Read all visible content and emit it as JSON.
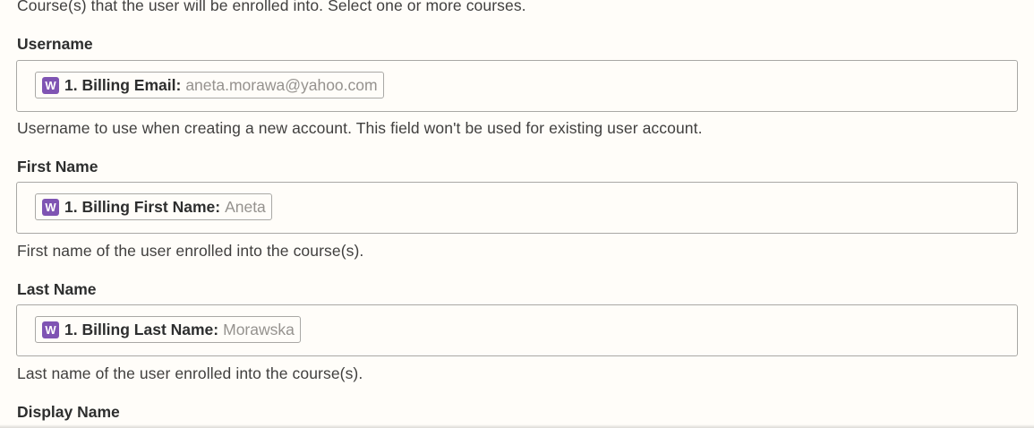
{
  "courses_help": "Course(s) that the user will be enrolled into. Select one or more courses.",
  "username": {
    "label": "Username",
    "pill_app": "W",
    "pill_label": "1. Billing Email:",
    "pill_value": "aneta.morawa@yahoo.com",
    "help": "Username to use when creating a new account. This field won't be used for existing user account."
  },
  "first_name": {
    "label": "First Name",
    "pill_app": "W",
    "pill_label": "1. Billing First Name:",
    "pill_value": "Aneta",
    "help": "First name of the user enrolled into the course(s)."
  },
  "last_name": {
    "label": "Last Name",
    "pill_app": "W",
    "pill_label": "1. Billing Last Name:",
    "pill_value": "Morawska",
    "help": "Last name of the user enrolled into the course(s)."
  },
  "display_name": {
    "label": "Display Name"
  },
  "colors": {
    "app_icon": "#7f54b3",
    "background": "#fffdf9",
    "border": "#a9a8a5"
  },
  "icons": {
    "app": "woocommerce-icon"
  }
}
